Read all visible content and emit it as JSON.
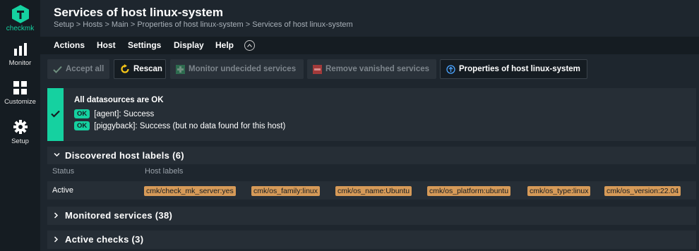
{
  "sidebar": {
    "logo_text": "checkmk",
    "items": [
      {
        "label": "Monitor",
        "icon": "bar-chart-icon"
      },
      {
        "label": "Customize",
        "icon": "grid-icon"
      },
      {
        "label": "Setup",
        "icon": "gear-icon"
      }
    ]
  },
  "header": {
    "title": "Services of host linux-system",
    "breadcrumb": "Setup > Hosts > Main > Properties of host linux-system > Services of host linux-system"
  },
  "menubar": {
    "items": [
      "Actions",
      "Host",
      "Settings",
      "Display",
      "Help"
    ]
  },
  "toolbar": {
    "accept_all": "Accept all",
    "rescan": "Rescan",
    "monitor_undecided": "Monitor undecided services",
    "remove_vanished": "Remove vanished services",
    "properties": "Properties of host linux-system"
  },
  "status": {
    "title": "All datasources are OK",
    "badge": "OK",
    "lines": [
      "[agent]: Success",
      "[piggyback]: Success (but no data found for this host)"
    ]
  },
  "sections": {
    "host_labels": {
      "title": "Discovered host labels (6)",
      "col_status": "Status",
      "col_labels": "Host labels",
      "row_status": "Active",
      "labels": [
        "cmk/check_mk_server:yes",
        "cmk/os_family:linux",
        "cmk/os_name:Ubuntu",
        "cmk/os_platform:ubuntu",
        "cmk/os_type:linux",
        "cmk/os_version:22.04"
      ]
    },
    "monitored": {
      "title": "Monitored services (38)"
    },
    "active_checks": {
      "title": "Active checks (3)"
    }
  },
  "colors": {
    "accent": "#15d1a0",
    "label_tag": "#d69a58",
    "background": "#1e262e",
    "sidebar": "#151c22",
    "remove_red": "#e04b4b"
  }
}
